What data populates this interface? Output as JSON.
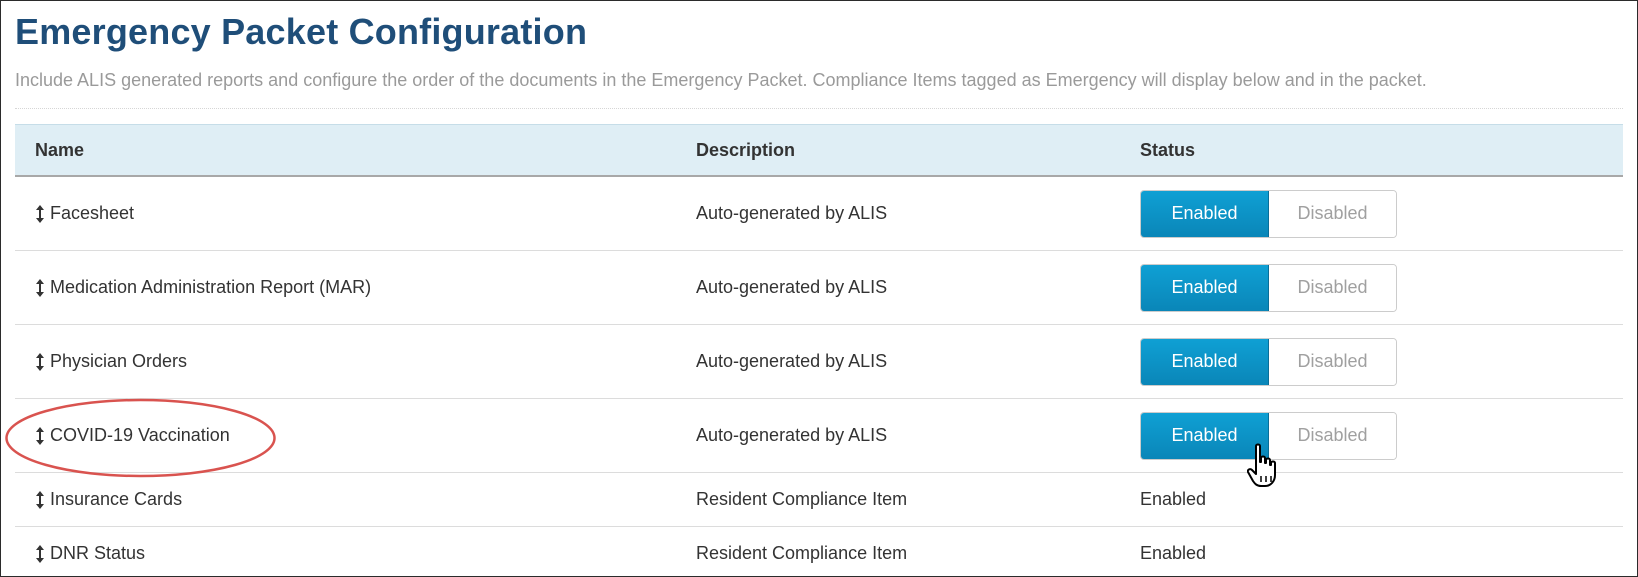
{
  "page": {
    "title": "Emergency Packet Configuration",
    "subtitle": "Include ALIS generated reports and configure the order of the documents in the Emergency Packet. Compliance Items tagged as Emergency will display below and in the packet."
  },
  "table": {
    "headers": {
      "name": "Name",
      "description": "Description",
      "status": "Status"
    },
    "rows": [
      {
        "name": "Facesheet",
        "description": "Auto-generated by ALIS",
        "status_type": "toggle",
        "enabled_label": "Enabled",
        "disabled_label": "Disabled",
        "selected": "Enabled"
      },
      {
        "name": "Medication Administration Report (MAR)",
        "description": "Auto-generated by ALIS",
        "status_type": "toggle",
        "enabled_label": "Enabled",
        "disabled_label": "Disabled",
        "selected": "Enabled"
      },
      {
        "name": "Physician Orders",
        "description": "Auto-generated by ALIS",
        "status_type": "toggle",
        "enabled_label": "Enabled",
        "disabled_label": "Disabled",
        "selected": "Enabled"
      },
      {
        "name": "COVID-19 Vaccination",
        "description": "Auto-generated by ALIS",
        "status_type": "toggle",
        "enabled_label": "Enabled",
        "disabled_label": "Disabled",
        "selected": "Enabled"
      },
      {
        "name": "Insurance Cards",
        "description": "Resident Compliance Item",
        "status_type": "text",
        "status": "Enabled"
      },
      {
        "name": "DNR Status",
        "description": "Resident Compliance Item",
        "status_type": "text",
        "status": "Enabled"
      }
    ]
  },
  "icons": {
    "drag_handle": "vertical-arrows-icon",
    "cursor": "hand-pointer-icon"
  },
  "colors": {
    "title": "#1f4e79",
    "subtitle": "#9a9a9a",
    "header_bg": "#dfeef5",
    "enabled_bg": "#0a96c8",
    "annotation": "#d9534f"
  }
}
